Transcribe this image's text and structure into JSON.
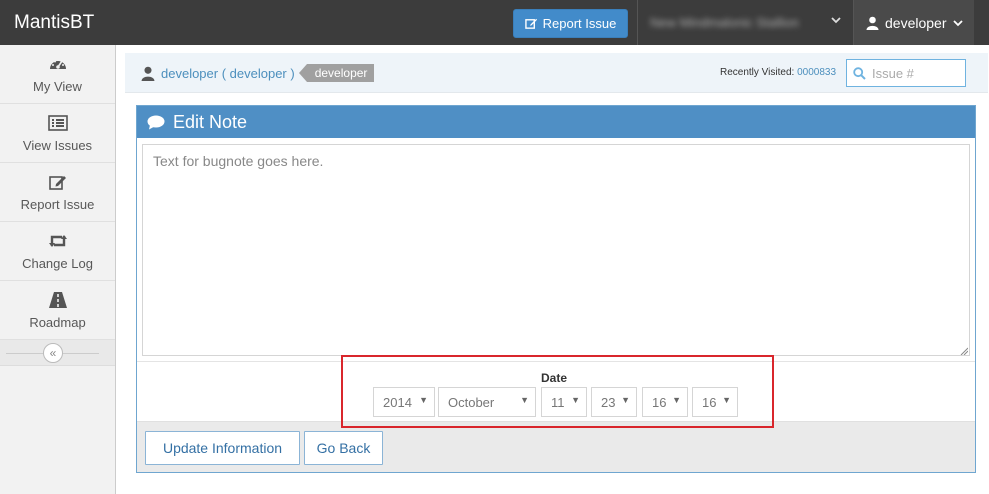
{
  "navbar": {
    "brand": "MantisBT",
    "report_button": "Report Issue",
    "project_name": "New Mindmalonic Stallion",
    "user_label": "developer"
  },
  "sidebar": {
    "items": [
      {
        "label": "My View",
        "icon": "dashboard-icon"
      },
      {
        "label": "View Issues",
        "icon": "list-icon"
      },
      {
        "label": "Report Issue",
        "icon": "edit-icon"
      },
      {
        "label": "Change Log",
        "icon": "retweet-icon"
      },
      {
        "label": "Roadmap",
        "icon": "road-icon"
      }
    ],
    "collapse_glyph": "«"
  },
  "breadcrumbs": {
    "user_link": "developer ( developer )",
    "role_tag": "developer",
    "recently_visited_label": "Recently Visited:",
    "recently_visited_id": "0000833",
    "search_placeholder": "Issue #"
  },
  "edit_note": {
    "title": "Edit Note",
    "note_text": "Text for bugnote goes here.",
    "date_label": "Date",
    "date": {
      "year": "2014",
      "month": "October",
      "day": "11",
      "hour": "23",
      "minute": "16",
      "second": "16"
    },
    "update_button": "Update Information",
    "back_button": "Go Back"
  },
  "colors": {
    "navbar_bg": "#3c3c3c",
    "primary_blue": "#428bca",
    "widget_header": "#4f8fc5",
    "highlight_red": "#d9262c"
  }
}
